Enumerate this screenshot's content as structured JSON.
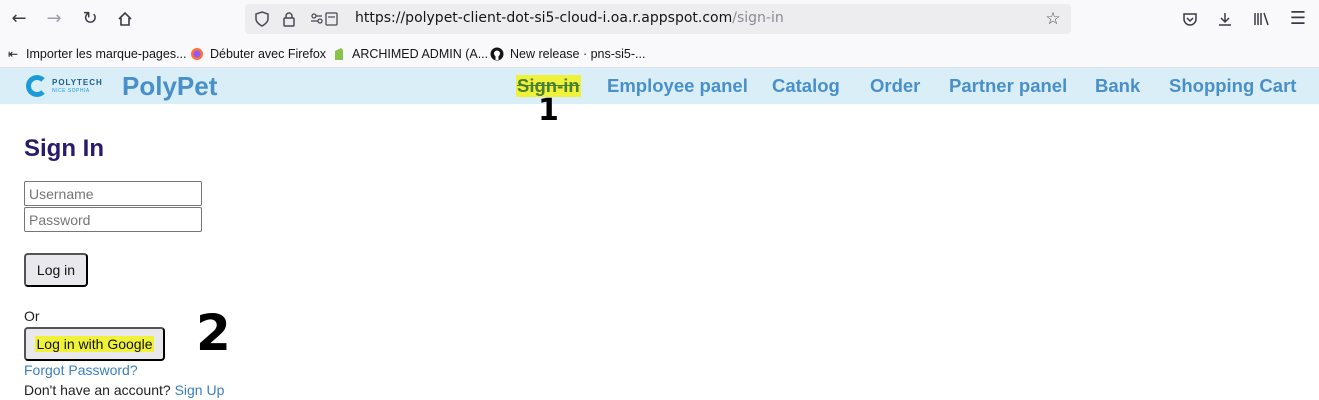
{
  "browser": {
    "url_main": "https://polypet-client-dot-si5-cloud-i.oa.r.appspot.com",
    "url_path": "/sign-in",
    "bookmarks": [
      {
        "label": "Importer les marque-pages...",
        "icon": "import-icon"
      },
      {
        "label": "Débuter avec Firefox",
        "icon": "firefox-icon"
      },
      {
        "label": "ARCHIMED ADMIN (A...",
        "icon": "archimed-icon"
      },
      {
        "label": "New release · pns-si5-...",
        "icon": "github-icon"
      }
    ]
  },
  "navbar": {
    "brand": "PolyPet",
    "logo_main": "POLYTECH",
    "logo_sub": "NICE SOPHIA",
    "links": [
      "Sign-in",
      "Employee panel",
      "Catalog",
      "Order",
      "Partner panel",
      "Bank",
      "Shopping Cart"
    ]
  },
  "annotations": {
    "one": "1",
    "two": "2"
  },
  "signin": {
    "title": "Sign In",
    "username_placeholder": "Username",
    "password_placeholder": "Password",
    "login_label": "Log in",
    "or_text": "Or",
    "google_label": "Log in with Google",
    "forgot_label": "Forgot Password?",
    "no_account_text": "Don't have an account?",
    "signup_label": "Sign Up"
  },
  "colors": {
    "navbar_bg": "#daeef8",
    "nav_link": "#4a90c8",
    "highlight": "#f0f23a",
    "title": "#2b1a6b",
    "link": "#3a7fc0"
  }
}
